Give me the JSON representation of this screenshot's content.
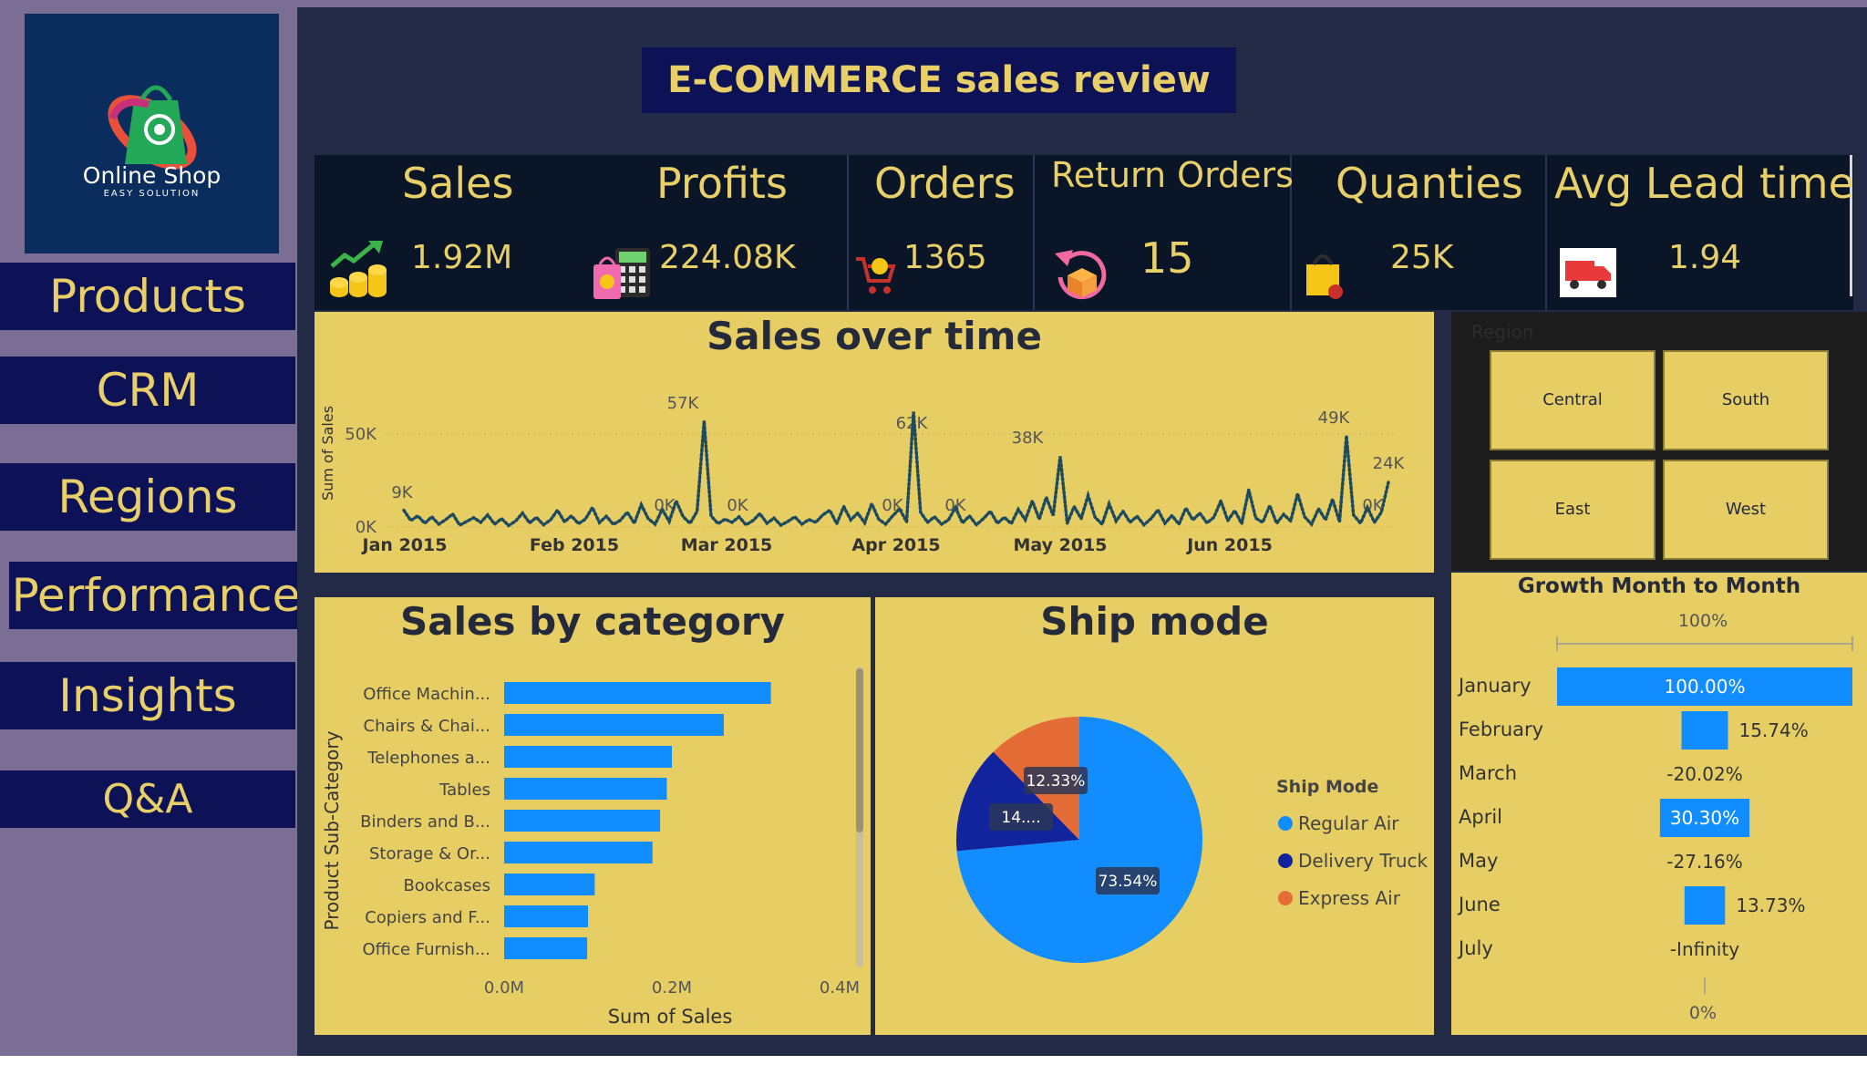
{
  "logo": {
    "name": "Online Shop",
    "tagline": "EASY SOLUTION"
  },
  "nav": [
    "Products",
    "CRM",
    "Regions",
    "Performance",
    "Insights",
    "Q&A"
  ],
  "title": "E-COMMERCE sales review",
  "kpis": [
    {
      "label": "Sales",
      "value": "1.92M",
      "icon": "money-growth-icon"
    },
    {
      "label": "Profits",
      "value": "224.08K",
      "icon": "shopping-calculator-icon"
    },
    {
      "label": "Orders",
      "value": "1365",
      "icon": "cart-icon"
    },
    {
      "label": "Return Orders",
      "value": "15",
      "icon": "return-box-icon"
    },
    {
      "label": "Quanties",
      "value": "25K",
      "icon": "shopping-bag-icon"
    },
    {
      "label": "Avg Lead time",
      "value": "1.94",
      "icon": "delivery-truck-icon"
    }
  ],
  "sales_over_time": {
    "title": "Sales over time",
    "ylabel": "Sum of Sales",
    "yticks": [
      "50K",
      "0K"
    ],
    "months": [
      "Jan 2015",
      "Feb 2015",
      "Mar 2015",
      "Apr 2015",
      "May 2015",
      "Jun 2015"
    ],
    "labels": [
      "57K",
      "62K",
      "38K",
      "49K",
      "24K",
      "9K",
      "0K",
      "0K",
      "0K",
      "0K",
      "0K"
    ]
  },
  "region": {
    "header": "Region",
    "items": [
      "Central",
      "South",
      "East",
      "West"
    ]
  },
  "growth": {
    "title": "Growth Month to Month",
    "top_label": "100%",
    "bottom_label": "0%",
    "months": [
      "January",
      "February",
      "March",
      "April",
      "May",
      "June",
      "July"
    ],
    "labels": [
      "100.00%",
      "15.74%",
      "-20.02%",
      "30.30%",
      "-27.16%",
      "13.73%",
      "-Infinity"
    ],
    "values": [
      100.0,
      15.74,
      -20.02,
      30.3,
      -27.16,
      13.73,
      null
    ]
  },
  "chart_data": [
    {
      "type": "line",
      "title": "Sales over time",
      "ylabel": "Sum of Sales",
      "x": [
        "Jan 2015",
        "Feb 2015",
        "Mar 2015",
        "Apr 2015",
        "May 2015",
        "Jun 2015"
      ],
      "ylim": [
        0,
        60000
      ],
      "annotations": [
        {
          "date": "2015-01-03",
          "value": 9000
        },
        {
          "date": "2015-02-22",
          "value": 57000
        },
        {
          "date": "2015-04-09",
          "value": 62000
        },
        {
          "date": "2015-05-19",
          "value": 38000
        },
        {
          "date": "2015-07-04",
          "value": 49000
        },
        {
          "date": "2015-07-14",
          "value": 24000
        }
      ],
      "series": [
        {
          "values": [
            9000,
            3500,
            6000,
            2000,
            5500,
            1500,
            4000,
            7000,
            1000,
            3000,
            5000,
            2500,
            6500,
            1500,
            4500,
            800,
            3200,
            7500,
            2200,
            5200,
            1200,
            3800,
            9000,
            2800,
            6000,
            1800,
            4200,
            10500,
            2400,
            5800,
            1400,
            3600,
            8000,
            2000,
            12000,
            4500,
            1500,
            9500,
            3000,
            14000,
            5500,
            2000,
            8500,
            57000,
            6000,
            1800,
            4200,
            2500,
            5500,
            1200,
            3500,
            7200,
            2000,
            4800,
            1000,
            3000,
            5500,
            1500,
            4000,
            2500,
            6500,
            9000,
            1800,
            11000,
            3800,
            7500,
            2200,
            12500,
            4200,
            1500,
            6000,
            9800,
            2800,
            62000,
            8000,
            2500,
            5500,
            1500,
            3800,
            10500,
            2200,
            6000,
            1200,
            4500,
            8500,
            2000,
            5200,
            1800,
            9500,
            3800,
            14000,
            4200,
            16000,
            6200,
            38000,
            2000,
            11000,
            4500,
            17000,
            5200,
            1500,
            12500,
            3200,
            8500,
            2500,
            5800,
            1200,
            4500,
            9200,
            2000,
            6200,
            1500,
            10200,
            3800,
            7500,
            2200,
            5200,
            14000,
            3500,
            8800,
            1800,
            20000,
            4800,
            2500,
            11500,
            2000,
            6800,
            3200,
            18000,
            5500,
            1500,
            9800,
            3800,
            15000,
            2800,
            49000,
            6500,
            2000,
            10500,
            2500,
            8000,
            24000
          ]
        }
      ]
    },
    {
      "type": "bar",
      "title": "Sales by category",
      "orientation": "horizontal",
      "categories": [
        "Office Machin...",
        "Chairs & Chai...",
        "Telephones a...",
        "Tables",
        "Binders and B...",
        "Storage & Or...",
        "Bookcases",
        "Copiers and F...",
        "Office Furnish..."
      ],
      "values": [
        0.318,
        0.262,
        0.2,
        0.194,
        0.186,
        0.177,
        0.108,
        0.1,
        0.099
      ],
      "xlabel": "Sum of Sales",
      "ylabel": "Product Sub-Category",
      "xticks": [
        "0.0M",
        "0.2M",
        "0.4M"
      ],
      "xlim": [
        0,
        0.4
      ],
      "color": "#118dff"
    },
    {
      "type": "pie",
      "title": "Ship mode",
      "legend_title": "Ship Mode",
      "legend_position": "right",
      "labels": [
        "Regular Air",
        "Delivery Truck",
        "Express Air"
      ],
      "values": [
        73.54,
        14.13,
        12.33
      ],
      "slice_labels": [
        "73.54%",
        "14....",
        "12.33%"
      ],
      "colors": [
        "#118dff",
        "#12239e",
        "#e66c37"
      ]
    },
    {
      "type": "bar",
      "title": "Growth Month to Month",
      "orientation": "horizontal",
      "categories": [
        "January",
        "February",
        "March",
        "April",
        "May",
        "June",
        "July"
      ],
      "values": [
        100.0,
        15.74,
        -20.02,
        30.3,
        -27.16,
        13.73,
        null
      ],
      "color": "#118dff"
    }
  ]
}
